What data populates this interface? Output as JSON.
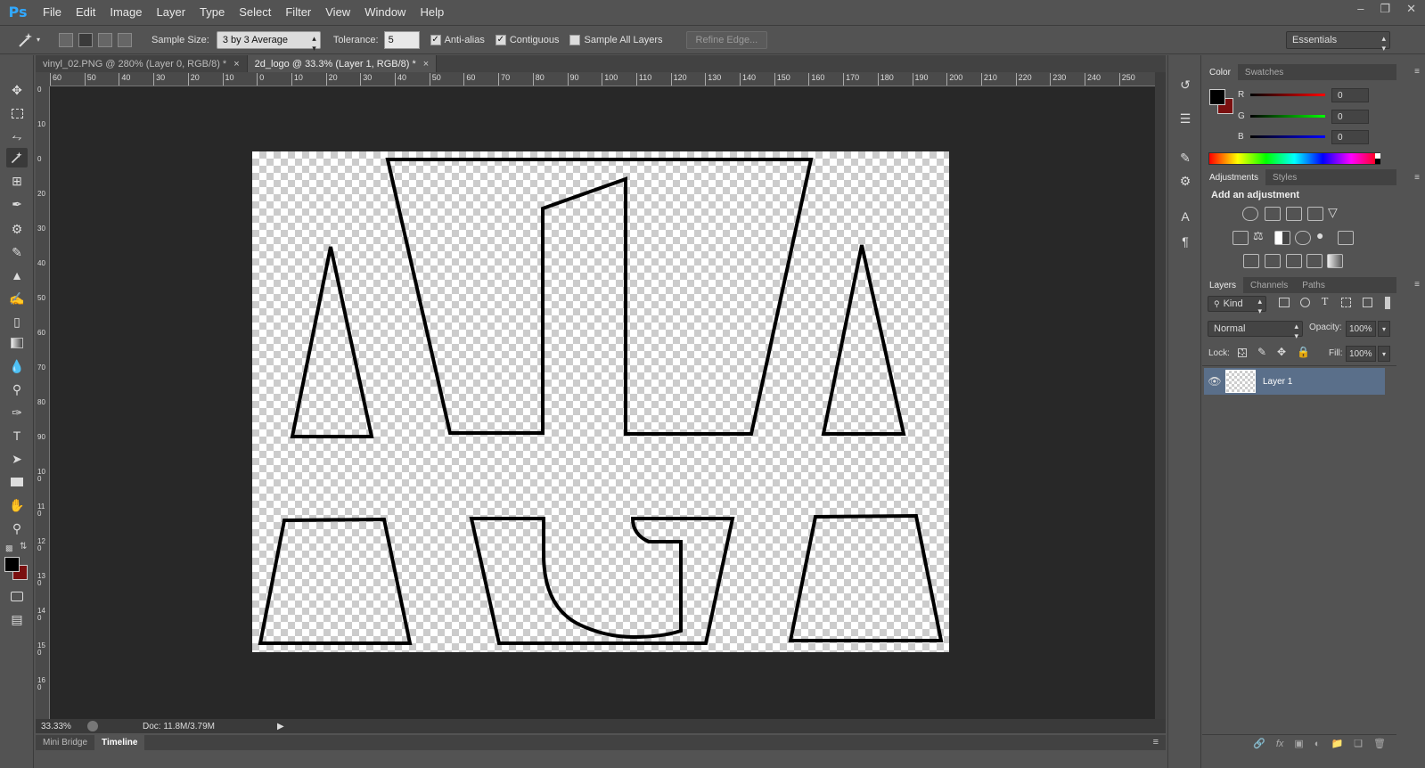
{
  "app": {
    "logo": "Ps"
  },
  "menu": [
    "File",
    "Edit",
    "Image",
    "Layer",
    "Type",
    "Select",
    "Filter",
    "View",
    "Window",
    "Help"
  ],
  "window_controls": {
    "minimize": "–",
    "restore": "❐",
    "close": "✕"
  },
  "options": {
    "sample_size_label": "Sample Size:",
    "sample_size_value": "3 by 3 Average",
    "tolerance_label": "Tolerance:",
    "tolerance_value": "5",
    "anti_alias_label": "Anti-alias",
    "anti_alias_checked": true,
    "contiguous_label": "Contiguous",
    "contiguous_checked": true,
    "sample_all_layers_label": "Sample All Layers",
    "sample_all_layers_checked": false,
    "refine_edge_label": "Refine Edge...",
    "workspace": "Essentials"
  },
  "tabs": [
    {
      "label": "vinyl_02.PNG @ 280% (Layer 0, RGB/8) *",
      "active": false
    },
    {
      "label": "2d_logo @ 33.3% (Layer 1, RGB/8) *",
      "active": true
    }
  ],
  "ruler_top_labels": [
    "60",
    "50",
    "40",
    "30",
    "20",
    "10",
    "0",
    "10",
    "20",
    "30",
    "40",
    "50",
    "60",
    "70",
    "80",
    "90",
    "100",
    "110",
    "120",
    "130",
    "140",
    "150",
    "160",
    "170",
    "180",
    "190",
    "200",
    "210",
    "220",
    "230",
    "240",
    "250"
  ],
  "ruler_left_labels": [
    "0",
    "10",
    "0",
    "20",
    "30",
    "40",
    "50",
    "60",
    "70",
    "80",
    "90",
    "100",
    "110",
    "120",
    "130",
    "140",
    "150",
    "160"
  ],
  "status": {
    "zoom": "33.33%",
    "doc": "Doc: 11.8M/3.79M"
  },
  "bottom_tabs": [
    "Mini Bridge",
    "Timeline"
  ],
  "color_panel": {
    "tabs": [
      "Color",
      "Swatches"
    ],
    "r_label": "R",
    "r_value": "0",
    "g_label": "G",
    "g_value": "0",
    "b_label": "B",
    "b_value": "0",
    "foreground": "#000000",
    "background": "#7a1010"
  },
  "adjustments_panel": {
    "tabs": [
      "Adjustments",
      "Styles"
    ],
    "heading": "Add an adjustment"
  },
  "layers_panel": {
    "tabs": [
      "Layers",
      "Channels",
      "Paths"
    ],
    "filter_kind": "Kind",
    "blend_mode": "Normal",
    "opacity_label": "Opacity:",
    "opacity_value": "100%",
    "lock_label": "Lock:",
    "fill_label": "Fill:",
    "fill_value": "100%",
    "layers": [
      {
        "name": "Layer 1",
        "visible": true,
        "selected": true
      }
    ]
  }
}
